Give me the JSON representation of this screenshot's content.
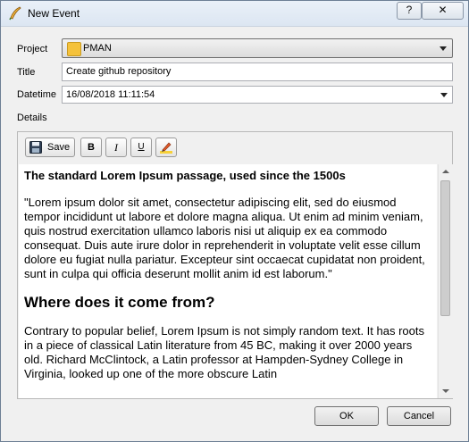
{
  "window": {
    "title": "New Event",
    "help_label": "?",
    "close_label": "✕"
  },
  "form": {
    "project_label": "Project",
    "project_value": "PMAN",
    "project_color": "#f5c23b",
    "title_label": "Title",
    "title_value": "Create github repository",
    "datetime_label": "Datetime",
    "datetime_value": "16/08/2018 11:11:54",
    "details_label": "Details"
  },
  "toolbar": {
    "save_label": "Save",
    "bold_label": "B",
    "italic_label": "I",
    "underline_label": "U",
    "icons": [
      "save-disk-icon",
      "highlight-pen-icon"
    ]
  },
  "content": {
    "heading1": "The standard Lorem Ipsum passage, used since the 1500s",
    "paragraph1": "\"Lorem ipsum dolor sit amet, consectetur adipiscing elit, sed do eiusmod tempor incididunt ut labore et dolore magna aliqua. Ut enim ad minim veniam, quis nostrud exercitation ullamco laboris nisi ut aliquip ex ea commodo consequat. Duis aute irure dolor in reprehenderit in voluptate velit esse cillum dolore eu fugiat nulla pariatur. Excepteur sint occaecat cupidatat non proident, sunt in culpa qui officia deserunt mollit anim id est laborum.\"",
    "heading2": "Where does it come from?",
    "paragraph2": "Contrary to popular belief, Lorem Ipsum is not simply random text. It has roots in a piece of classical Latin literature from 45 BC, making it over 2000 years old. Richard McClintock, a Latin professor at Hampden-Sydney College in Virginia, looked up one of the more obscure Latin"
  },
  "buttons": {
    "ok_label": "OK",
    "cancel_label": "Cancel"
  }
}
